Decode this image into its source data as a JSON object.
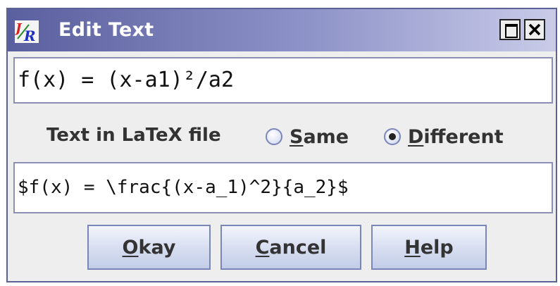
{
  "window": {
    "title": "Edit Text",
    "icon": "app-logo-icon",
    "controls": [
      "maximize-icon",
      "close-icon"
    ]
  },
  "fields": {
    "text_value": "f(x) = (x-a1)²/a2",
    "latex_value": "$f(x) = \\frac{(x-a_1)^2}{a_2}$"
  },
  "latex_option": {
    "label": "Text in LaTeX file",
    "options": [
      {
        "mnemonic": "S",
        "rest": "ame",
        "selected": false
      },
      {
        "mnemonic": "D",
        "rest": "ifferent",
        "selected": true
      }
    ]
  },
  "buttons": {
    "okay": {
      "mnemonic": "O",
      "rest": "kay"
    },
    "cancel": {
      "mnemonic": "C",
      "rest": "ancel"
    },
    "help": {
      "mnemonic": "H",
      "rest": "elp"
    }
  }
}
